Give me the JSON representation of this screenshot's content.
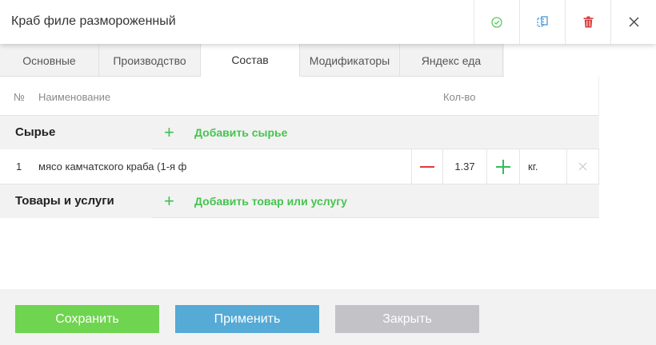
{
  "header": {
    "title": "Краб филе размороженный",
    "colors": {
      "check": "#5cc65c",
      "copy": "#3a8fd9",
      "delete": "#d83a3a",
      "close": "#444444"
    }
  },
  "tabs": [
    {
      "label": "Основные",
      "active": false
    },
    {
      "label": "Производство",
      "active": false
    },
    {
      "label": "Состав",
      "active": true
    },
    {
      "label": "Модификаторы",
      "active": false
    },
    {
      "label": "Яндекс еда",
      "active": false
    }
  ],
  "table": {
    "columns": {
      "num": "№",
      "name": "Наименование",
      "qty": "Кол-во"
    },
    "sections": [
      {
        "name": "Сырье",
        "add_label": "Добавить сырье",
        "rows": [
          {
            "num": "1",
            "name": "мясо камчатского краба (1-я ф",
            "qty": "1.37",
            "unit": "кг."
          }
        ]
      },
      {
        "name": "Товары и услуги",
        "add_label": "Добавить товар или услугу",
        "rows": []
      }
    ]
  },
  "footer": {
    "save_label": "Сохранить",
    "apply_label": "Применить",
    "close_label": "Закрыть",
    "colors": {
      "save": "#6fd44f",
      "apply": "#55aad6",
      "close": "#c2c2c7"
    }
  }
}
